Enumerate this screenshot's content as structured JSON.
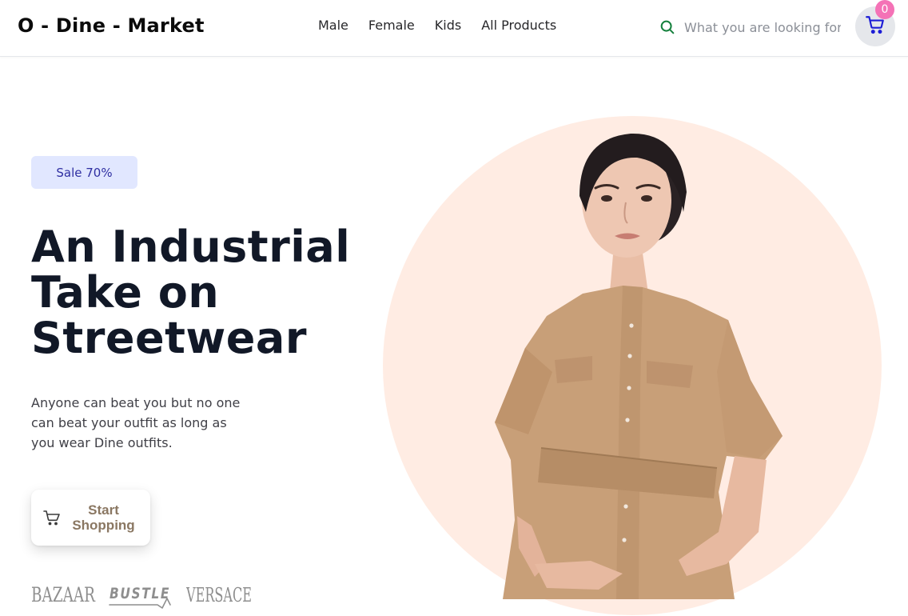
{
  "header": {
    "logo": "O - Dine - Market",
    "nav": [
      {
        "label": "Male"
      },
      {
        "label": "Female"
      },
      {
        "label": "Kids"
      },
      {
        "label": "All Products"
      }
    ],
    "search": {
      "placeholder": "What you are looking for",
      "value": "",
      "icon": "search-icon"
    },
    "cart": {
      "count": "0",
      "icon": "cart-icon"
    }
  },
  "hero": {
    "badge": "Sale 70%",
    "title_lines": [
      "An Industrial",
      "Take on",
      "Streetwear"
    ],
    "description": "Anyone can beat you but no one can beat your outfit as long as you wear Dine outfits.",
    "cta": {
      "label": "Start Shopping",
      "icon": "cart-icon"
    },
    "brands": [
      {
        "name": "BAZAAR"
      },
      {
        "name": "BUSTLE"
      },
      {
        "name": "VERSACE"
      }
    ],
    "image": {
      "description_icon": "model-photo"
    }
  },
  "colors": {
    "accent_green": "#15803d",
    "cart_blue": "#1d1dd6",
    "badge_pink": "#f472b6",
    "sale_bg": "#e1e7ff",
    "sale_text": "#2f2fa2",
    "circle_bg": "#ffece3",
    "cta_text": "#8a7762"
  }
}
